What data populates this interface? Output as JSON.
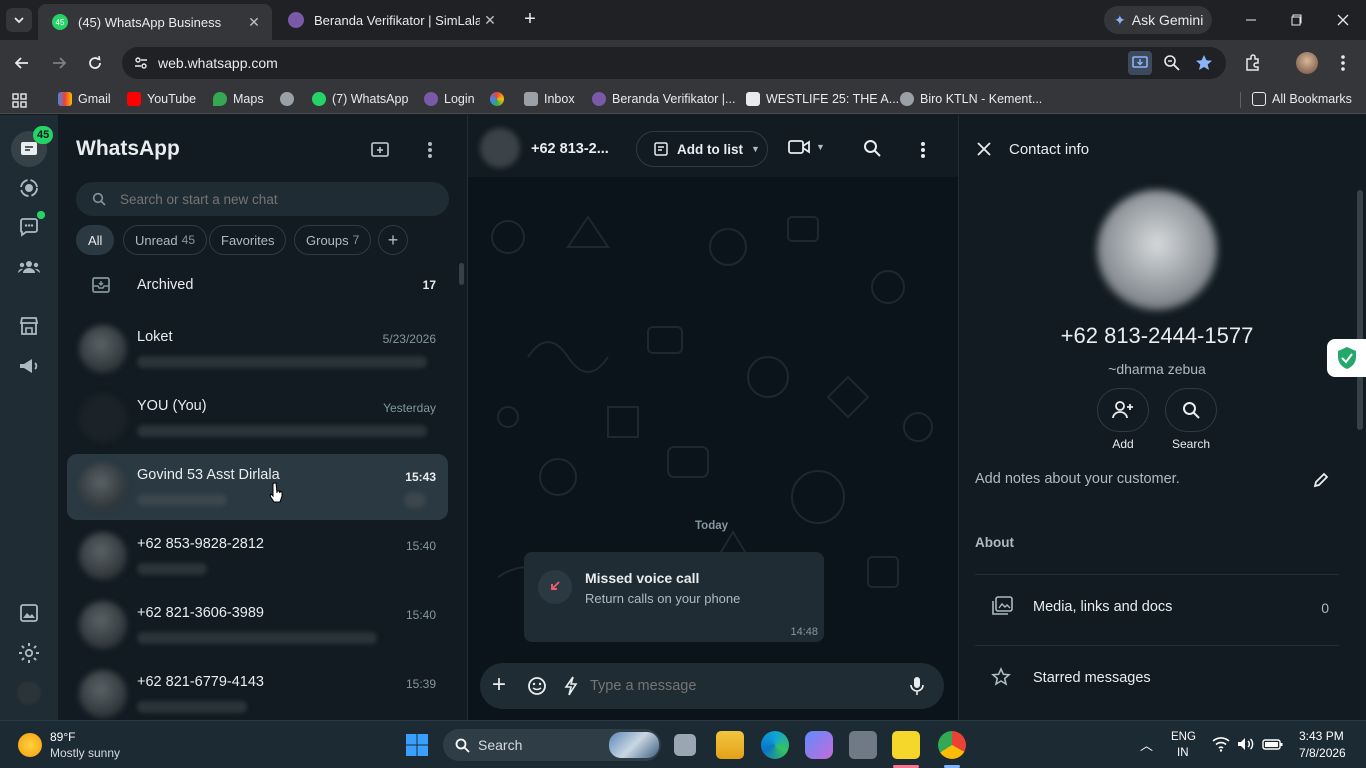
{
  "browser": {
    "tabs": [
      {
        "title": "(45) WhatsApp Business",
        "badge": "45"
      },
      {
        "title": "Beranda Verifikator | SimLala"
      }
    ],
    "ask_gemini": "Ask Gemini",
    "url": "web.whatsapp.com",
    "bookmarks": [
      "Gmail",
      "YouTube",
      "Maps",
      "(7) WhatsApp",
      "Login",
      "Inbox",
      "Beranda Verifikator |...",
      "WESTLIFE 25: THE A...",
      "Biro KTLN - Kement..."
    ],
    "all_bookmarks": "All Bookmarks"
  },
  "rail": {
    "chats_badge": "45"
  },
  "chatlist": {
    "title": "WhatsApp",
    "search_placeholder": "Search or start a new chat",
    "filters": [
      {
        "label": "All"
      },
      {
        "label": "Unread",
        "count": "45"
      },
      {
        "label": "Favorites"
      },
      {
        "label": "Groups",
        "count": "7"
      }
    ],
    "archived_label": "Archived",
    "archived_count": "17",
    "chats": [
      {
        "name": "Loket",
        "time": "5/23/2026"
      },
      {
        "name": "YOU (You)",
        "time": "Yesterday"
      },
      {
        "name": "Govind 53 Asst Dirlala",
        "time": "15:43"
      },
      {
        "name": "+62 853-9828-2812",
        "time": "15:40"
      },
      {
        "name": "+62 821-3606-3989",
        "time": "15:40"
      },
      {
        "name": "+62 821-6779-4143",
        "time": "15:39"
      }
    ]
  },
  "chatpane": {
    "contact": "+62 813-2...",
    "add_to_list": "Add to list",
    "day_label": "Today",
    "missed_title": "Missed voice call",
    "missed_sub": "Return calls on your phone",
    "missed_time": "14:48",
    "composer_placeholder": "Type a message"
  },
  "contact_info": {
    "header": "Contact info",
    "phone": "+62 813-2444-1577",
    "name": "~dharma zebua",
    "add_label": "Add",
    "search_label": "Search",
    "notes_placeholder": "Add notes about your customer.",
    "about_label": "About",
    "media_label": "Media, links and docs",
    "media_count": "0",
    "starred_label": "Starred messages"
  },
  "taskbar": {
    "temp": "89°F",
    "weather": "Mostly sunny",
    "search": "Search",
    "lang1": "ENG",
    "lang2": "IN",
    "time": "3:43 PM",
    "date": "7/8/2026"
  },
  "colors": {
    "accent": "#25d366",
    "panel": "#111b21",
    "rail": "#202c33"
  }
}
